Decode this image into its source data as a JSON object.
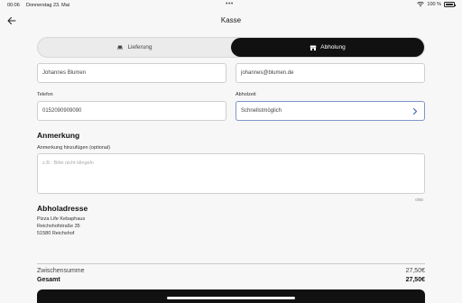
{
  "statusbar": {
    "time": "00:06",
    "date": "Donnerstag 23. Mai",
    "dots": "•••",
    "battery_text": "100 %"
  },
  "nav": {
    "title": "Kasse"
  },
  "segment": {
    "delivery_label": "Lieferung",
    "pickup_label": "Abholung",
    "selected": "Abholung"
  },
  "form": {
    "name_value": "Johannes Blumen",
    "email_value": "johannes@blumen.de",
    "phone_label": "Telefon",
    "phone_value": "0152090909090",
    "pickup_time_label": "Abholzeit",
    "pickup_time_value": "Schnellstmöglich"
  },
  "note": {
    "title": "Anmerkung",
    "label": "Anmerkung hinzufügen (optional)",
    "placeholder": "z.B.: Bitte nicht klingeln",
    "counter": "0/80"
  },
  "pickup_address": {
    "title": "Abholadresse",
    "lines": [
      "Pizza Life Kebaphaus",
      "Reichshofstraße 35",
      "51580 Reichshof"
    ]
  },
  "summary": {
    "subtotal_label": "Zwischensumme",
    "subtotal_value": "27,50€",
    "total_label": "Gesamt",
    "total_value": "27,50€"
  }
}
